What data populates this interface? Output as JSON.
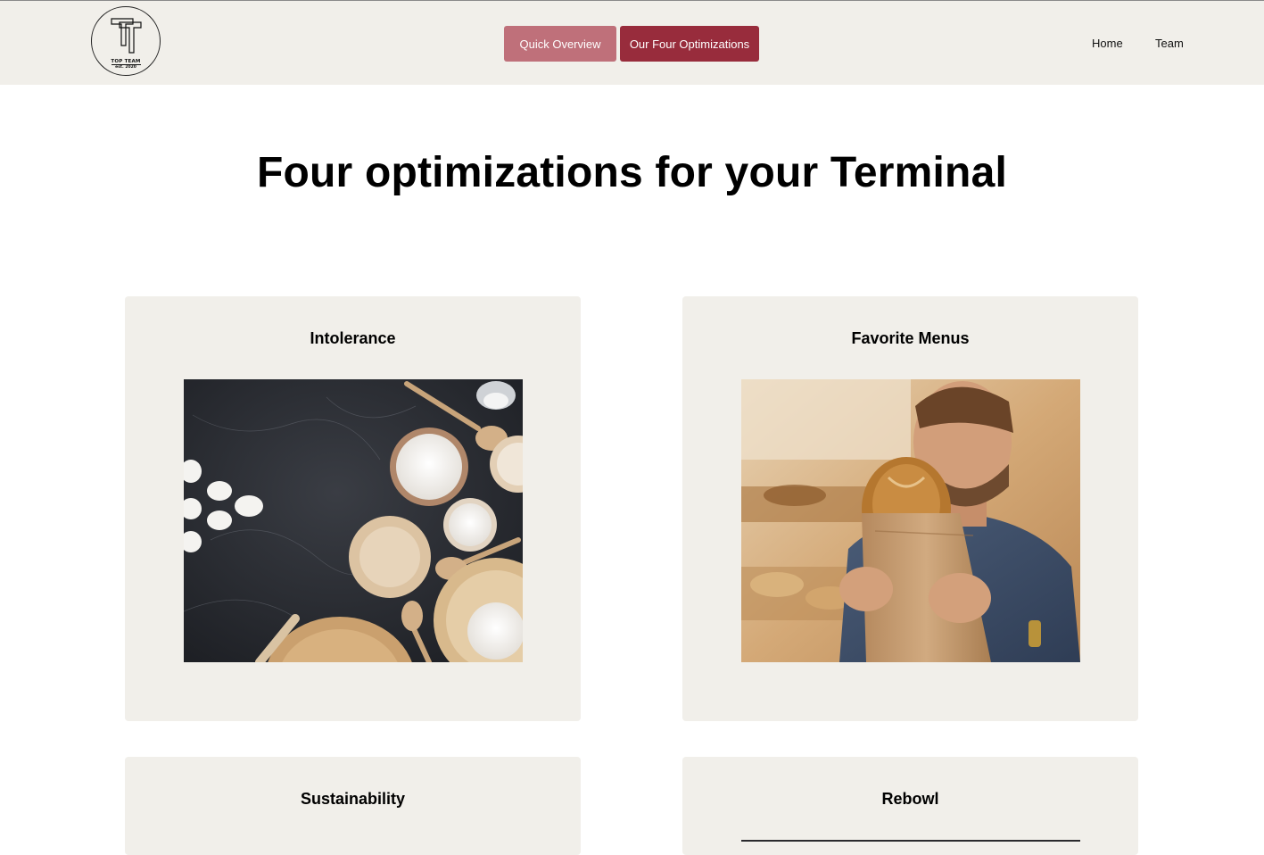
{
  "header": {
    "logo": {
      "monogram": "TT",
      "name": "TOP TEAM",
      "established": "est. 2020"
    },
    "buttons": {
      "quick_overview": "Quick Overview",
      "our_four_optimizations": "Our Four Optimizations"
    },
    "nav": {
      "home": "Home",
      "team": "Team"
    }
  },
  "main": {
    "title": "Four optimizations for your Terminal",
    "cards": [
      {
        "title": "Intolerance",
        "image": "baking-ingredients-photo"
      },
      {
        "title": "Favorite Menus",
        "image": "man-smelling-bread-photo"
      },
      {
        "title": "Sustainability"
      },
      {
        "title": "Rebowl"
      }
    ]
  },
  "colors": {
    "header_bg": "#f1efea",
    "card_bg": "#f1efea",
    "button_light": "#bf707a",
    "button_dark": "#982c3c"
  }
}
